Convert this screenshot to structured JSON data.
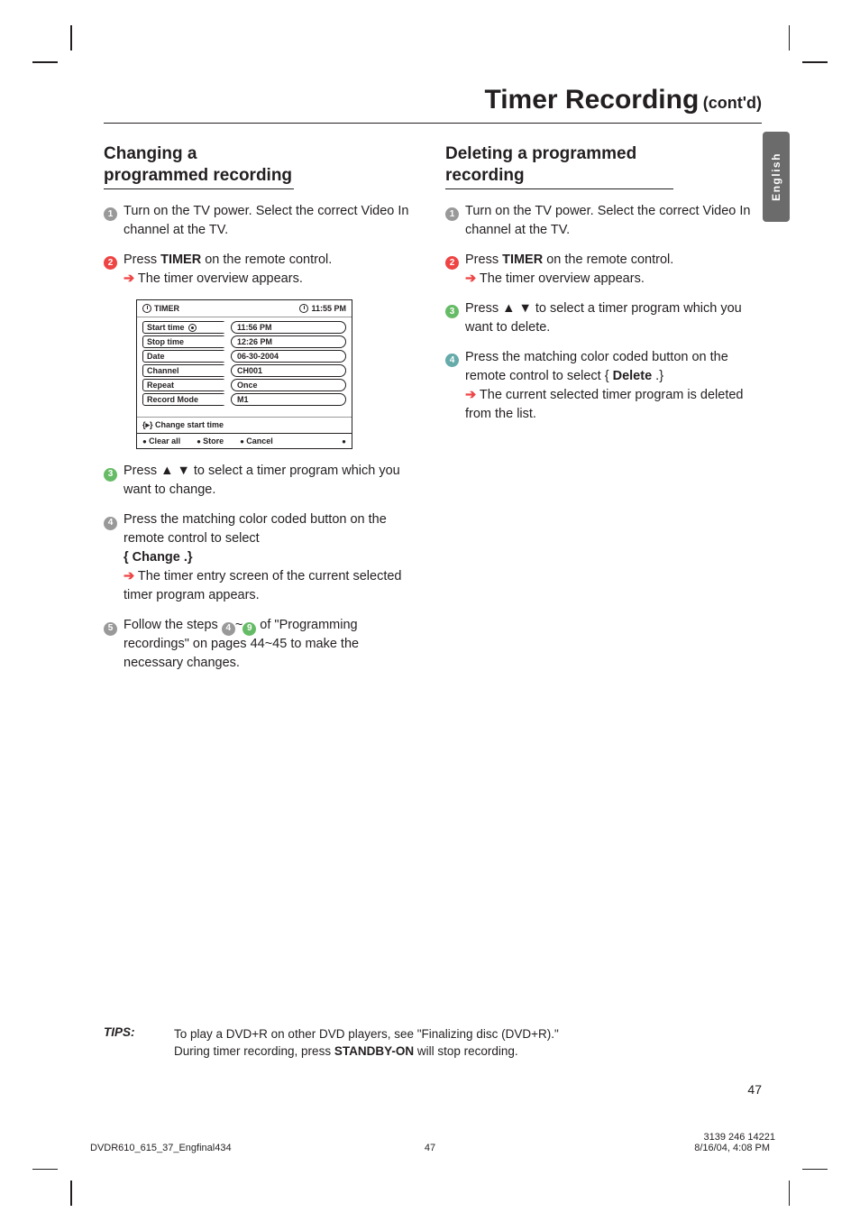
{
  "header": {
    "title_main": "Timer Recording",
    "title_suffix": "(cont'd)"
  },
  "sidetab": {
    "label": "English"
  },
  "left": {
    "section_title": "Changing a programmed recording",
    "steps": {
      "s1": "Turn on the TV power.  Select the correct Video In channel at the TV.",
      "s2_a": "Press ",
      "s2_b": "TIMER",
      "s2_c": " on the remote control.",
      "s2_res": " The timer overview appears.",
      "s3": "Press ▲ ▼ to select a timer program which you want to change.",
      "s4_a": "Press the matching color coded button on the remote control to select ",
      "s4_b": "{ Change .}",
      "s4_res": " The timer entry screen of the current selected timer program appears.",
      "s5_a": "Follow the steps ",
      "s5_b": "~",
      "s5_c": " of \"Programming recordings\" on pages 44~45 to make the necessary changes."
    },
    "timer": {
      "title": "TIMER",
      "clock": "11:55 PM",
      "rows": {
        "start_time": {
          "label": "Start time",
          "value": "11:56 PM"
        },
        "stop_time": {
          "label": "Stop time",
          "value": "12:26 PM"
        },
        "date": {
          "label": "Date",
          "value": "06-30-2004"
        },
        "channel": {
          "label": "Channel",
          "value": "CH001"
        },
        "repeat": {
          "label": "Repeat",
          "value": "Once"
        },
        "record": {
          "label": "Record Mode",
          "value": "M1"
        }
      },
      "hint": "{▸}  Change start time",
      "foot": {
        "a": "Clear all",
        "b": "Store",
        "c": "Cancel"
      }
    }
  },
  "right": {
    "section_title": "Deleting a programmed recording",
    "steps": {
      "s1": "Turn on the TV power.  Select the correct Video In channel at the TV.",
      "s2_a": "Press ",
      "s2_b": "TIMER",
      "s2_c": " on the remote control.",
      "s2_res": " The timer overview appears.",
      "s3": "Press ▲ ▼ to select a timer program which you want to delete.",
      "s4_a": "Press the matching color coded button on the remote control to select { ",
      "s4_b": "Delete",
      "s4_c": " .}",
      "s4_res": " The current selected timer program is deleted from the list."
    }
  },
  "tips": {
    "label": "TIPS:",
    "line1": "To play a DVD+R on other DVD players, see \"Finalizing disc (DVD+R).\"",
    "line2_a": "During timer recording, press ",
    "line2_b": "STANDBY-ON",
    "line2_c": " will stop recording."
  },
  "pagenum": "47",
  "footer": {
    "file": "DVDR610_615_37_Engfinal434",
    "page": "47",
    "date": "8/16/04, 4:08 PM",
    "partno": "3139 246 14221"
  }
}
